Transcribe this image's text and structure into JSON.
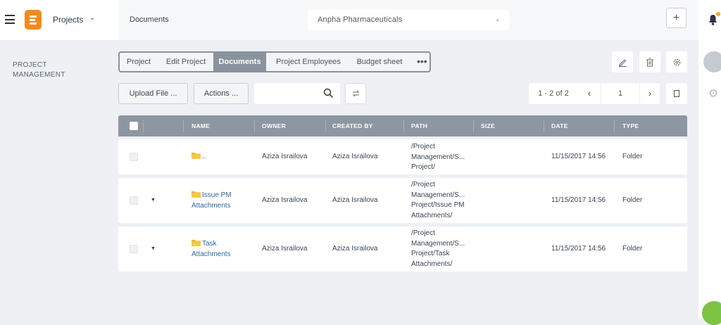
{
  "app": {
    "name": "Projects",
    "breadcrumb": "Documents",
    "company": "Anpha Pharmaceuticals"
  },
  "section_label": "PROJECT MANAGEMENT",
  "tabs": [
    {
      "label": "Project",
      "active": false
    },
    {
      "label": "Edit Project",
      "active": false
    },
    {
      "label": "Documents",
      "active": true
    },
    {
      "label": "Project Employees",
      "active": false
    },
    {
      "label": "Budget sheet",
      "active": false
    }
  ],
  "tabs_more": "•••",
  "toolbar": {
    "upload_label": "Upload File ...",
    "actions_label": "Actions ...",
    "search_placeholder": "",
    "pager_count": "1 - 2 of 2",
    "pager_page": "1",
    "prev": "‹",
    "next": "›"
  },
  "table": {
    "columns": [
      "NAME",
      "OWNER",
      "CREATED BY",
      "PATH",
      "SIZE",
      "DATE",
      "TYPE"
    ],
    "rows": [
      {
        "name": "..",
        "owner": "Aziza Israilova",
        "created_by": "Aziza Israilova",
        "path": [
          "/Project",
          "Management/S...",
          "Project/"
        ],
        "size": "",
        "date": "11/15/2017 14:56",
        "type": "Folder",
        "expandable": false
      },
      {
        "name": "Issue PM Attachments",
        "owner": "Aziza Israilova",
        "created_by": "Aziza Israilova",
        "path": [
          "/Project",
          "Management/S...",
          "Project/Issue PM",
          "Attachments/"
        ],
        "size": "",
        "date": "11/15/2017 14:56",
        "type": "Folder",
        "expandable": true
      },
      {
        "name": "Task Attachments",
        "owner": "Aziza Israilova",
        "created_by": "Aziza Israilova",
        "path": [
          "/Project",
          "Management/S...",
          "Project/Task",
          "Attachments/"
        ],
        "size": "",
        "date": "11/15/2017 14:56",
        "type": "Folder",
        "expandable": true
      }
    ]
  },
  "colors": {
    "accent_orange": "#f28a1e",
    "header_gray": "#8d96a1",
    "link_blue": "#2b6aa3",
    "chat_green": "#7cc243"
  },
  "icons": [
    "menu-icon",
    "brand-logo",
    "chevron-down-icon",
    "plus-icon",
    "bell-icon",
    "edit-icon",
    "trash-icon",
    "settings-icon",
    "search-icon",
    "refresh-icon",
    "document-icon",
    "folder-icon",
    "gear-icon",
    "chat-icon"
  ]
}
